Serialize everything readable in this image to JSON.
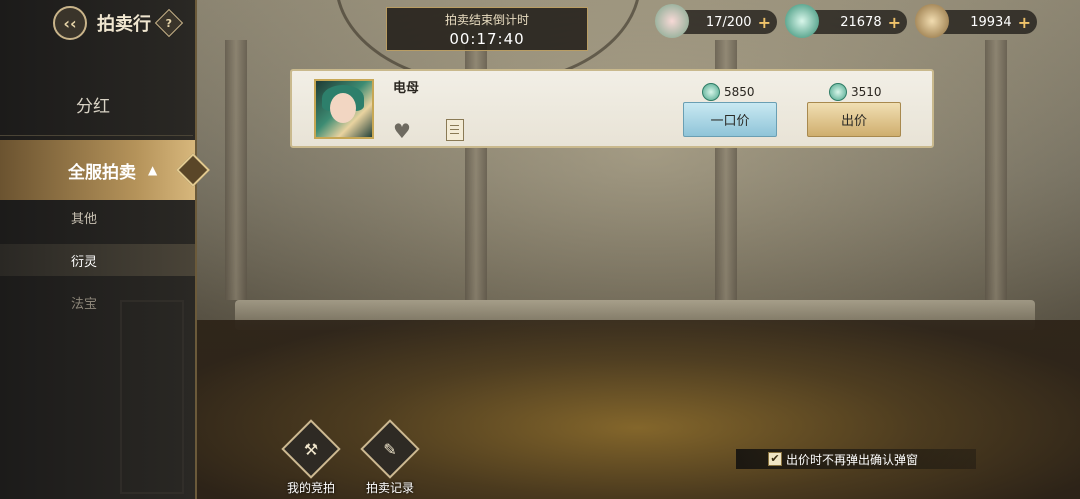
{
  "sidebar": {
    "title": "拍卖行",
    "help": "?",
    "items": [
      {
        "label": "分红"
      },
      {
        "label": "全服拍卖"
      }
    ],
    "sub_items": [
      {
        "label": "其他"
      },
      {
        "label": "衍灵"
      },
      {
        "label": "法宝"
      }
    ]
  },
  "timer": {
    "label": "拍卖结束倒计时",
    "value": "00:17:40"
  },
  "currencies": [
    {
      "value": "17/200",
      "icon": "stamina-flower-icon"
    },
    {
      "value": "21678",
      "icon": "jade-icon"
    },
    {
      "value": "19934",
      "icon": "coin-icon"
    }
  ],
  "item": {
    "name": "电母",
    "buyout_price": "5850",
    "bid_price": "3510",
    "buyout_label": "一口价",
    "bid_label": "出价"
  },
  "bottom": {
    "my_bids_label": "我的竞拍",
    "records_label": "拍卖记录",
    "confirm_label": "出价时不再弹出确认弹窗",
    "confirm_checked": true
  },
  "colors": {
    "accent": "#c9b48a",
    "buyout": "#8fc4d8",
    "bid": "#cfae6e"
  }
}
